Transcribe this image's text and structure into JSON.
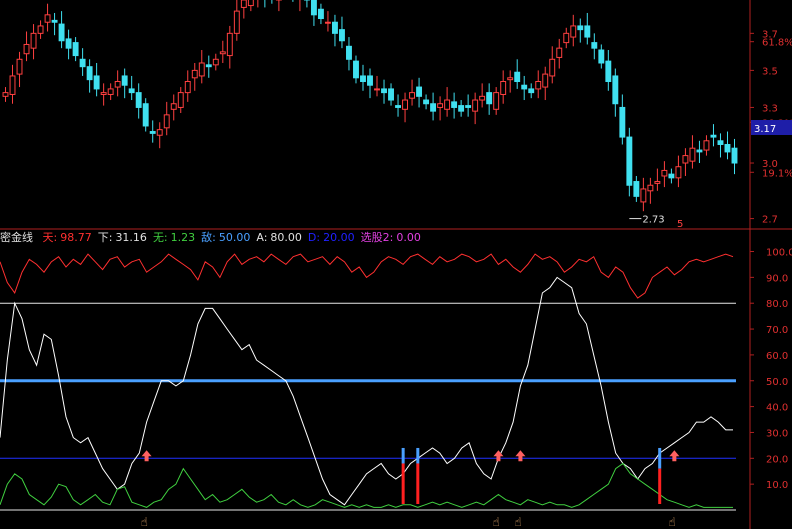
{
  "indicator": {
    "name": "密金线",
    "params": [
      {
        "label": "天:",
        "value": "98.77",
        "color": "#ff3030"
      },
      {
        "label": "下:",
        "value": "31.16",
        "color": "#e0e0e0"
      },
      {
        "label": "无:",
        "value": "1.23",
        "color": "#40d040"
      },
      {
        "label": "敌:",
        "value": "50.00",
        "color": "#4aa0ff"
      },
      {
        "label": "A:",
        "value": "80.00",
        "color": "#e0e0e0"
      },
      {
        "label": "D:",
        "value": "20.00",
        "color": "#2020ff"
      },
      {
        "label": "选股2:",
        "value": "0.00",
        "color": "#e040e0"
      }
    ]
  },
  "price_panel": {
    "current_price": "3.17",
    "low_marker": "2.73",
    "low_marker_color": "#e0e0e0",
    "axis_labels": [
      "3.7",
      "61.8%",
      "3.5",
      "3.3",
      "38.2%",
      "3.0",
      "19.1%",
      "2.7"
    ],
    "bottom_mark": "5",
    "up_color": "#ff4040",
    "down_color": "#40e0f0"
  },
  "chart_data": [
    {
      "type": "candlestick",
      "title": "",
      "ylim": [
        2.66,
        3.88
      ],
      "axis_ticks": [
        3.7,
        3.5,
        3.3,
        3.0,
        2.7
      ],
      "fib_levels": [
        {
          "label": "61.8%",
          "value": 3.655
        },
        {
          "label": "38.2%",
          "value": 3.22
        },
        {
          "label": "19.1%",
          "value": 2.95
        }
      ],
      "close": [
        3.38,
        3.47,
        3.56,
        3.64,
        3.7,
        3.74,
        3.8,
        3.76,
        3.66,
        3.62,
        3.58,
        3.52,
        3.45,
        3.4,
        3.38,
        3.4,
        3.44,
        3.42,
        3.38,
        3.3,
        3.2,
        3.16,
        3.18,
        3.26,
        3.32,
        3.38,
        3.44,
        3.5,
        3.54,
        3.52,
        3.56,
        3.6,
        3.7,
        3.82,
        3.88,
        3.9,
        3.92,
        3.91,
        3.9,
        3.92,
        3.94,
        3.92,
        3.9,
        3.88,
        3.8,
        3.78,
        3.76,
        3.7,
        3.66,
        3.56,
        3.46,
        3.44,
        3.42,
        3.4,
        3.38,
        3.34,
        3.3,
        3.34,
        3.38,
        3.36,
        3.32,
        3.28,
        3.32,
        3.34,
        3.3,
        3.28,
        3.3,
        3.34,
        3.36,
        3.32,
        3.38,
        3.44,
        3.46,
        3.44,
        3.4,
        3.38,
        3.44,
        3.48,
        3.56,
        3.62,
        3.7,
        3.74,
        3.72,
        3.68,
        3.62,
        3.54,
        3.44,
        3.32,
        3.14,
        2.88,
        2.82,
        2.86,
        2.88,
        2.9,
        2.96,
        2.92,
        2.98,
        3.04,
        3.08,
        3.06,
        3.12,
        3.14,
        3.1,
        3.06,
        3.0
      ]
    },
    {
      "type": "line",
      "title": "",
      "ylim": [
        0,
        106
      ],
      "y_ticks": [
        100.0,
        90.0,
        80.0,
        70.0,
        60.0,
        50.0,
        40.0,
        30.0,
        20.0,
        10.0
      ],
      "horizontal_lines": [
        {
          "value": 80,
          "color": "#e8e8e8",
          "width": 1
        },
        {
          "value": 50,
          "color": "#4aa0ff",
          "width": 3
        },
        {
          "value": 20,
          "color": "#2030ff",
          "width": 1
        },
        {
          "value": 0,
          "color": "#e8e8e8",
          "width": 1
        }
      ],
      "series": [
        {
          "name": "天",
          "color": "#ff3030",
          "values": [
            96,
            88,
            84,
            92,
            97,
            95,
            92,
            96,
            98,
            94,
            97,
            95,
            99,
            96,
            93,
            97,
            98,
            94,
            96,
            97,
            92,
            94,
            96,
            99,
            97,
            95,
            93,
            89,
            96,
            94,
            90,
            96,
            99,
            95,
            97,
            98,
            96,
            99,
            97,
            95,
            98,
            99,
            96,
            97,
            98,
            95,
            98,
            96,
            92,
            94,
            90,
            92,
            96,
            98,
            97,
            95,
            98,
            99,
            97,
            95,
            98,
            96,
            97,
            99,
            98,
            96,
            97,
            99,
            95,
            97,
            94,
            92,
            95,
            99,
            97,
            98,
            96,
            92,
            94,
            97,
            96,
            98,
            92,
            90,
            94,
            92,
            86,
            82,
            84,
            90,
            92,
            94,
            91,
            93,
            96,
            97,
            96,
            97,
            98,
            99,
            98
          ]
        },
        {
          "name": "下",
          "color": "#ffffff",
          "values": [
            28,
            58,
            80,
            74,
            62,
            56,
            68,
            66,
            52,
            36,
            28,
            26,
            28,
            22,
            16,
            12,
            8,
            10,
            18,
            22,
            34,
            42,
            50,
            50,
            48,
            50,
            60,
            72,
            78,
            78,
            74,
            70,
            66,
            62,
            64,
            58,
            56,
            54,
            52,
            50,
            44,
            36,
            28,
            20,
            12,
            6,
            4,
            2,
            6,
            10,
            14,
            16,
            18,
            14,
            12,
            14,
            18,
            20,
            22,
            24,
            22,
            18,
            20,
            24,
            26,
            18,
            14,
            12,
            20,
            26,
            34,
            48,
            56,
            70,
            84,
            86,
            90,
            88,
            86,
            76,
            72,
            60,
            48,
            34,
            22,
            18,
            16,
            12,
            16,
            18,
            22,
            24,
            26,
            28,
            30,
            34,
            34,
            36,
            34,
            31,
            31
          ]
        },
        {
          "name": "无",
          "color": "#40d040",
          "values": [
            2,
            10,
            14,
            12,
            6,
            4,
            2,
            5,
            10,
            9,
            4,
            2,
            4,
            6,
            3,
            2,
            8,
            9,
            3,
            2,
            1,
            3,
            4,
            8,
            10,
            16,
            12,
            8,
            4,
            6,
            3,
            4,
            6,
            8,
            5,
            3,
            4,
            6,
            3,
            2,
            4,
            2,
            1,
            2,
            4,
            3,
            2,
            1,
            2,
            1,
            2,
            1,
            1,
            2,
            1,
            2,
            2,
            1,
            2,
            3,
            2,
            3,
            2,
            1,
            2,
            3,
            2,
            4,
            6,
            4,
            3,
            2,
            4,
            3,
            2,
            3,
            2,
            2,
            1,
            2,
            4,
            6,
            8,
            10,
            16,
            18,
            14,
            12,
            10,
            8,
            6,
            4,
            3,
            2,
            1,
            2,
            1,
            1,
            1,
            1,
            1
          ]
        }
      ],
      "signal_bars": [
        {
          "x": 55,
          "blue_top": 24,
          "red_top": 18
        },
        {
          "x": 57,
          "blue_top": 24,
          "red_top": 18
        },
        {
          "x": 90,
          "blue_top": 24,
          "red_top": 16
        }
      ],
      "up_arrows": [
        20,
        68,
        71,
        92
      ],
      "hand_icons": [
        20,
        68,
        71,
        92
      ]
    }
  ]
}
